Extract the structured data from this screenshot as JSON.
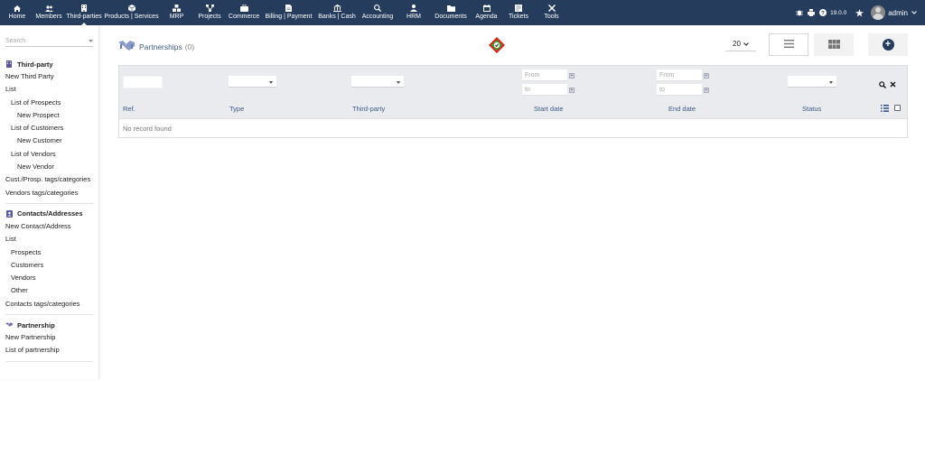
{
  "topmenu": [
    {
      "key": "home",
      "label": "Home",
      "icon": "home-icon"
    },
    {
      "key": "members",
      "label": "Members",
      "icon": "users-icon"
    },
    {
      "key": "thirdparties",
      "label": "Third-parties",
      "icon": "building-icon",
      "active": true
    },
    {
      "key": "products",
      "label": "Products | Services",
      "icon": "cube-icon"
    },
    {
      "key": "mrp",
      "label": "MRP",
      "icon": "cubes-icon"
    },
    {
      "key": "projects",
      "label": "Projects",
      "icon": "sitemap-icon"
    },
    {
      "key": "commerce",
      "label": "Commerce",
      "icon": "suitcase-icon"
    },
    {
      "key": "billing",
      "label": "Billing | Payment",
      "icon": "file-invoice-icon"
    },
    {
      "key": "banks",
      "label": "Banks | Cash",
      "icon": "bank-icon"
    },
    {
      "key": "accounting",
      "label": "Accounting",
      "icon": "search-dollar-icon"
    },
    {
      "key": "hrm",
      "label": "HRM",
      "icon": "user-tie-icon"
    },
    {
      "key": "documents",
      "label": "Documents",
      "icon": "folder-icon"
    },
    {
      "key": "agenda",
      "label": "Agenda",
      "icon": "calendar-icon"
    },
    {
      "key": "tickets",
      "label": "Tickets",
      "icon": "ticket-icon"
    },
    {
      "key": "tools",
      "label": "Tools",
      "icon": "tools-icon"
    }
  ],
  "topright": {
    "version": "19.0.0",
    "user": "admin"
  },
  "sidebar": {
    "search_placeholder": "Search",
    "thirdparty": {
      "title": "Third-party",
      "links": [
        "New Third Party",
        "List",
        "List of Prospects",
        "New Prospect",
        "List of Customers",
        "New Customer",
        "List of Vendors",
        "New Vendor",
        "Cust./Prosp. tags/categories",
        "Vendors tags/categories"
      ]
    },
    "contacts": {
      "title": "Contacts/Addresses",
      "links": [
        "New Contact/Address",
        "List",
        "Prospects",
        "Customers",
        "Vendors",
        "Other",
        "Contacts tags/categories"
      ]
    },
    "partnership": {
      "title": "Partnership",
      "links": [
        "New Partnership",
        "List of partnership"
      ]
    }
  },
  "main": {
    "title": "Partnerships",
    "count": "(0)",
    "limit": "20",
    "filters": {
      "date_from": "From",
      "date_to": "to"
    },
    "columns": [
      "Ref.",
      "Type",
      "Third-party",
      "Start date",
      "End date",
      "Status"
    ],
    "empty_text": "No record found"
  },
  "colors": {
    "topbar": "#263c5c",
    "header_text": "#3d5a88",
    "filter_bg": "#e9ebee"
  }
}
